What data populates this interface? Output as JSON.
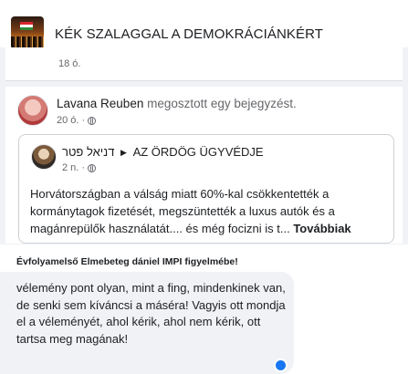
{
  "header": {
    "group_title": "KÉK SZALAGGAL A DEMOKRÁCIÁNKÉRT"
  },
  "previous_post": {
    "time": "18 ó."
  },
  "post": {
    "author": "Lavana Reuben",
    "action": "megosztott egy bejegyzést.",
    "time": "20 ó. ·",
    "privacy_icon": "globe-icon",
    "shared": {
      "author": "דניאל פטר",
      "arrow": "▶",
      "target": "AZ ÖRDÖG ÜGYVÉDJE",
      "time": "2 n. ·",
      "privacy_icon": "globe-icon",
      "text": "Horvátországban a válság miatt 60%-kal csökkentették a kormánytagok fizetését, megszüntették a luxus autók és a magánrepülők használatát.... és még focizni is t...",
      "see_more": "Továbbiak"
    }
  },
  "caption": "Évfolyamelső Elmebeteg dániel IMPI figyelmébe!",
  "comment": {
    "text": "vélemény pont olyan, mint a fing, mindenkinek van, de senki sem kíváncsi a máséra! Vagyis ott mondja el a véleményét, ahol kérik, ahol nem kérik, ott tartsa meg magának!"
  },
  "colors": {
    "feed_background": "#f0f2f5",
    "secondary_text": "#65676b",
    "reaction_blue": "#1877f2"
  }
}
